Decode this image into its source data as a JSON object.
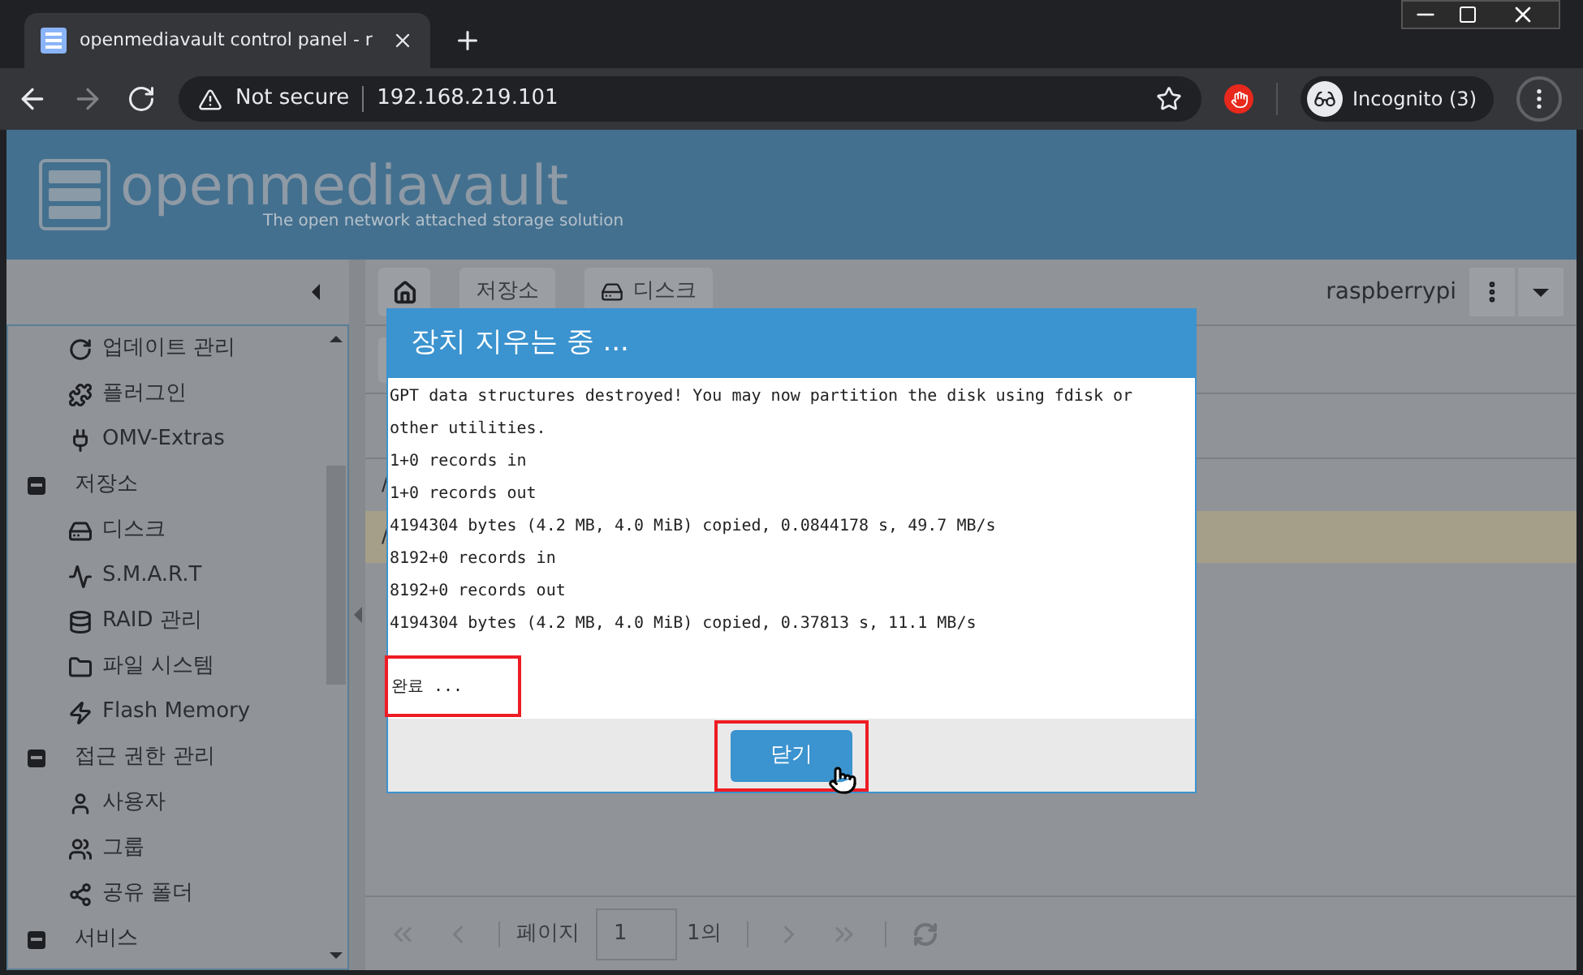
{
  "browser": {
    "tab_title": "openmediavault control panel - r",
    "address_warning": "Not secure",
    "url": "192.168.219.101",
    "profile": "Incognito (3)"
  },
  "header": {
    "logo_text": "openmediavault",
    "tagline": "The open network attached storage solution"
  },
  "sidebar": {
    "items": [
      {
        "kind": "item",
        "label": "업데이트 관리"
      },
      {
        "kind": "item",
        "label": "플러그인"
      },
      {
        "kind": "item",
        "label": "OMV-Extras"
      },
      {
        "kind": "group",
        "label": "저장소"
      },
      {
        "kind": "item",
        "label": "디스크"
      },
      {
        "kind": "item",
        "label": "S.M.A.R.T"
      },
      {
        "kind": "item",
        "label": "RAID 관리"
      },
      {
        "kind": "item",
        "label": "파일 시스템"
      },
      {
        "kind": "item",
        "label": "Flash Memory"
      },
      {
        "kind": "group",
        "label": "접근 권한 관리"
      },
      {
        "kind": "item",
        "label": "사용자"
      },
      {
        "kind": "item",
        "label": "그룹"
      },
      {
        "kind": "item",
        "label": "공유 폴더"
      },
      {
        "kind": "group",
        "label": "서비스"
      }
    ]
  },
  "breadcrumb": [
    "저장소",
    "디스크"
  ],
  "hostname": "raspberrypi",
  "table": {
    "rows": [
      {
        "cell": "/",
        "selected": false
      },
      {
        "cell": "/",
        "selected": true
      }
    ]
  },
  "pagination": {
    "page_label": "페이지",
    "page_value": "1",
    "page_total": "1의"
  },
  "dialog": {
    "title": "장치 지우는 중 ...",
    "output_lines": [
      "GPT data structures destroyed! You may now partition the disk using fdisk or",
      "other utilities.",
      "1+0 records in",
      "1+0 records out",
      "4194304 bytes (4.2 MB, 4.0 MiB) copied, 0.0844178 s, 49.7 MB/s",
      "8192+0 records in",
      "8192+0 records out",
      "4194304 bytes (4.2 MB, 4.0 MiB) copied, 0.37813 s, 11.1 MB/s"
    ],
    "status": "완료 ...",
    "close_button": "닫기"
  }
}
